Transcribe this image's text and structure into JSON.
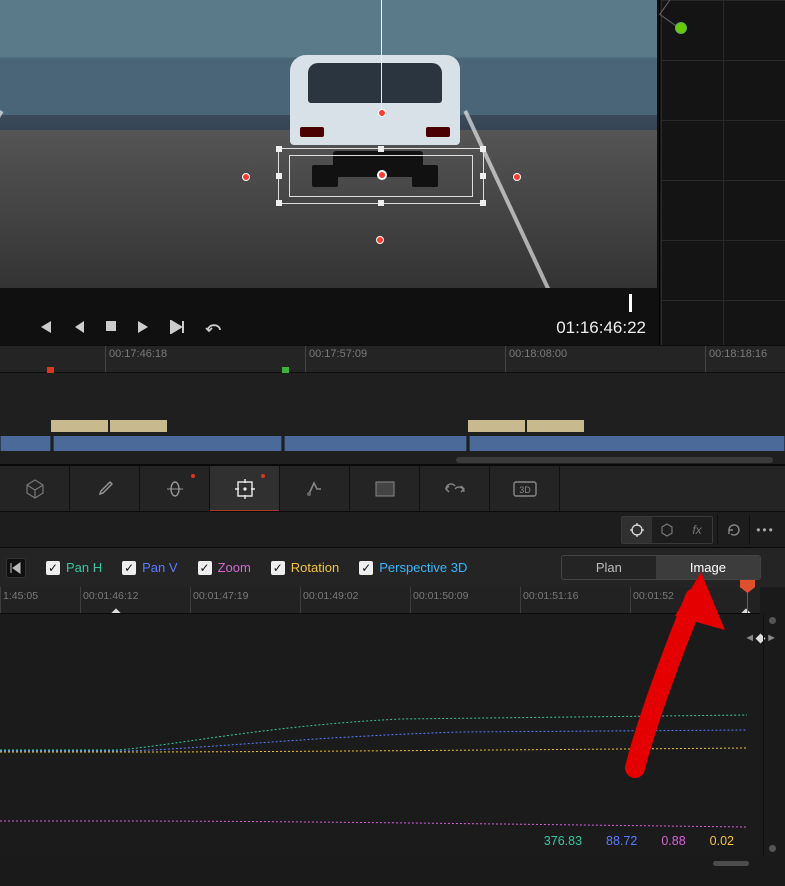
{
  "viewer": {
    "timecode": "01:16:46:22",
    "transport": {
      "prev_keyframe": "prev-keyframe",
      "step_back": "step-back",
      "stop": "stop",
      "play": "play",
      "next_keyframe": "next-keyframe",
      "loop": "loop"
    }
  },
  "ruler_main": {
    "ticks": [
      "00:17:46:18",
      "00:17:57:09",
      "00:18:08:00",
      "00:18:18:16"
    ]
  },
  "tool_tabs": {
    "items": [
      "nodes",
      "picker",
      "curves",
      "tracker",
      "qualifier",
      "window",
      "key",
      "3d"
    ],
    "active_index": 3
  },
  "tracker": {
    "checks": [
      {
        "label": "Pan H",
        "color": "#38c6a0"
      },
      {
        "label": "Pan V",
        "color": "#5a7dff"
      },
      {
        "label": "Zoom",
        "color": "#d765d7"
      },
      {
        "label": "Rotation",
        "color": "#f2c43b"
      },
      {
        "label": "Perspective 3D",
        "color": "#33b8ff"
      }
    ],
    "segment": {
      "options": [
        "Plan",
        "Image"
      ],
      "active": 1
    },
    "ruler": [
      "1:45:05",
      "00:01:46:12",
      "00:01:47:19",
      "00:01:49:02",
      "00:01:50:09",
      "00:01:51:16",
      "00:01:52"
    ],
    "values": [
      {
        "text": "376.83",
        "color": "#38c6a0"
      },
      {
        "text": "88.72",
        "color": "#5a7dff"
      },
      {
        "text": "0.88",
        "color": "#d765d7"
      },
      {
        "text": "0.02",
        "color": "#f2c43b"
      }
    ]
  },
  "icons": {
    "target": "target",
    "cube": "cube",
    "fx": "fx",
    "reset": "reset",
    "more": "more"
  }
}
